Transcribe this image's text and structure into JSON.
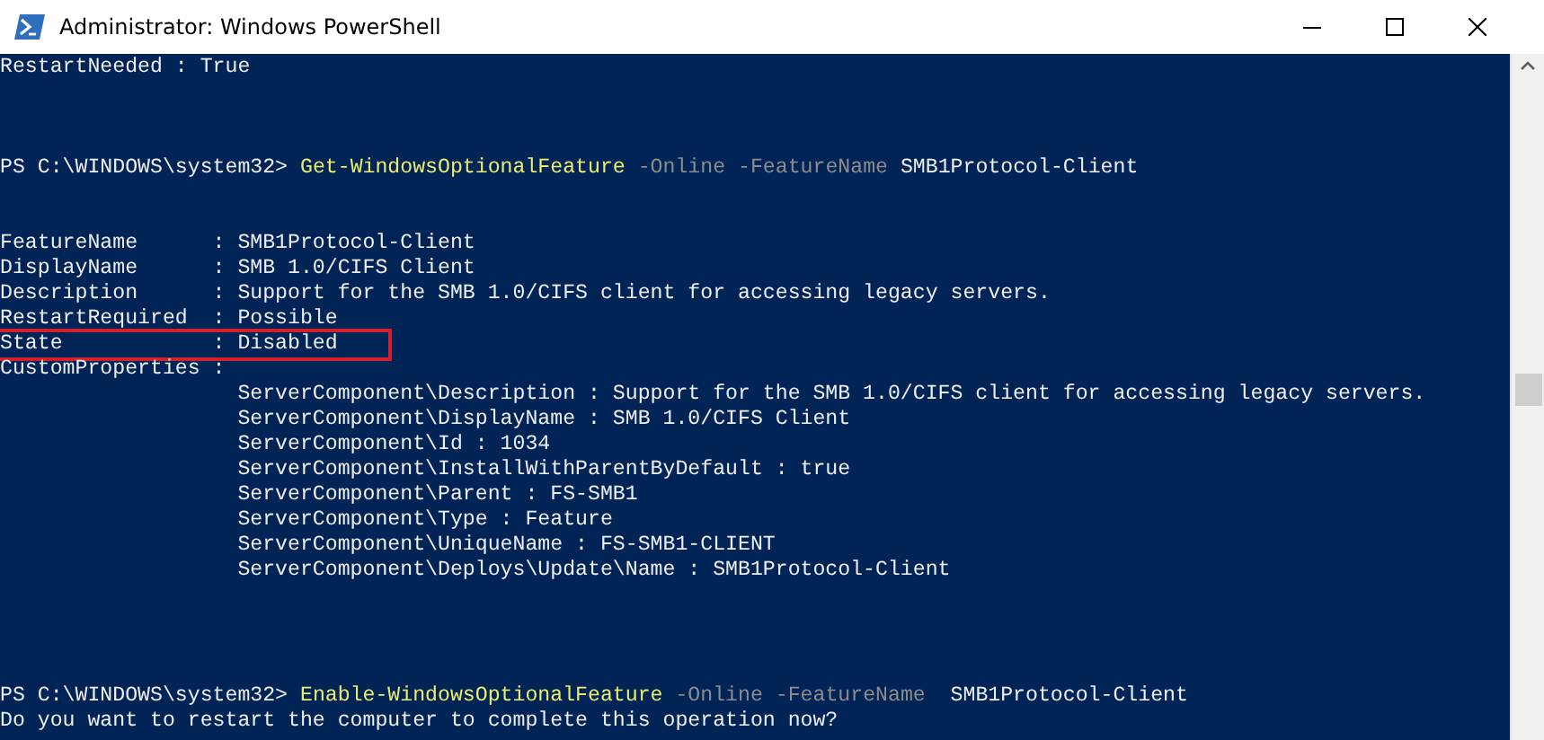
{
  "window": {
    "title": "Administrator: Windows PowerShell"
  },
  "console": {
    "lines": [
      {
        "kind": "text",
        "segments": [
          {
            "kind": "plain",
            "text": "RestartNeeded : True"
          }
        ]
      },
      {
        "kind": "blank"
      },
      {
        "kind": "blank"
      },
      {
        "kind": "blank"
      },
      {
        "kind": "text",
        "segments": [
          {
            "kind": "prompt",
            "text": "PS C:\\WINDOWS\\system32> "
          },
          {
            "kind": "command",
            "text": "Get-WindowsOptionalFeature"
          },
          {
            "kind": "parameter",
            "text": " -Online -FeatureName"
          },
          {
            "kind": "plain",
            "text": " SMB1Protocol-Client"
          }
        ]
      },
      {
        "kind": "blank"
      },
      {
        "kind": "blank"
      },
      {
        "kind": "text",
        "segments": [
          {
            "kind": "plain",
            "text": "FeatureName      : SMB1Protocol-Client"
          }
        ]
      },
      {
        "kind": "text",
        "segments": [
          {
            "kind": "plain",
            "text": "DisplayName      : SMB 1.0/CIFS Client"
          }
        ]
      },
      {
        "kind": "text",
        "segments": [
          {
            "kind": "plain",
            "text": "Description      : Support for the SMB 1.0/CIFS client for accessing legacy servers."
          }
        ]
      },
      {
        "kind": "text",
        "segments": [
          {
            "kind": "plain",
            "text": "RestartRequired  : Possible"
          }
        ]
      },
      {
        "kind": "text",
        "highlighted": true,
        "segments": [
          {
            "kind": "plain",
            "text": "State            : Disabled"
          }
        ]
      },
      {
        "kind": "text",
        "segments": [
          {
            "kind": "plain",
            "text": "CustomProperties :"
          }
        ]
      },
      {
        "kind": "text",
        "segments": [
          {
            "kind": "plain",
            "text": "                   ServerComponent\\Description : Support for the SMB 1.0/CIFS client for accessing legacy servers."
          }
        ]
      },
      {
        "kind": "text",
        "segments": [
          {
            "kind": "plain",
            "text": "                   ServerComponent\\DisplayName : SMB 1.0/CIFS Client"
          }
        ]
      },
      {
        "kind": "text",
        "segments": [
          {
            "kind": "plain",
            "text": "                   ServerComponent\\Id : 1034"
          }
        ]
      },
      {
        "kind": "text",
        "segments": [
          {
            "kind": "plain",
            "text": "                   ServerComponent\\InstallWithParentByDefault : true"
          }
        ]
      },
      {
        "kind": "text",
        "segments": [
          {
            "kind": "plain",
            "text": "                   ServerComponent\\Parent : FS-SMB1"
          }
        ]
      },
      {
        "kind": "text",
        "segments": [
          {
            "kind": "plain",
            "text": "                   ServerComponent\\Type : Feature"
          }
        ]
      },
      {
        "kind": "text",
        "segments": [
          {
            "kind": "plain",
            "text": "                   ServerComponent\\UniqueName : FS-SMB1-CLIENT"
          }
        ]
      },
      {
        "kind": "text",
        "segments": [
          {
            "kind": "plain",
            "text": "                   ServerComponent\\Deploys\\Update\\Name : SMB1Protocol-Client"
          }
        ]
      },
      {
        "kind": "blank"
      },
      {
        "kind": "blank"
      },
      {
        "kind": "blank"
      },
      {
        "kind": "blank"
      },
      {
        "kind": "text",
        "segments": [
          {
            "kind": "prompt",
            "text": "PS C:\\WINDOWS\\system32> "
          },
          {
            "kind": "command",
            "text": "Enable-WindowsOptionalFeature"
          },
          {
            "kind": "parameter",
            "text": " -Online -FeatureName"
          },
          {
            "kind": "plain",
            "text": "  SMB1Protocol-Client"
          }
        ]
      },
      {
        "kind": "text",
        "segments": [
          {
            "kind": "plain",
            "text": "Do you want to restart the computer to complete this operation now?"
          }
        ]
      }
    ]
  }
}
